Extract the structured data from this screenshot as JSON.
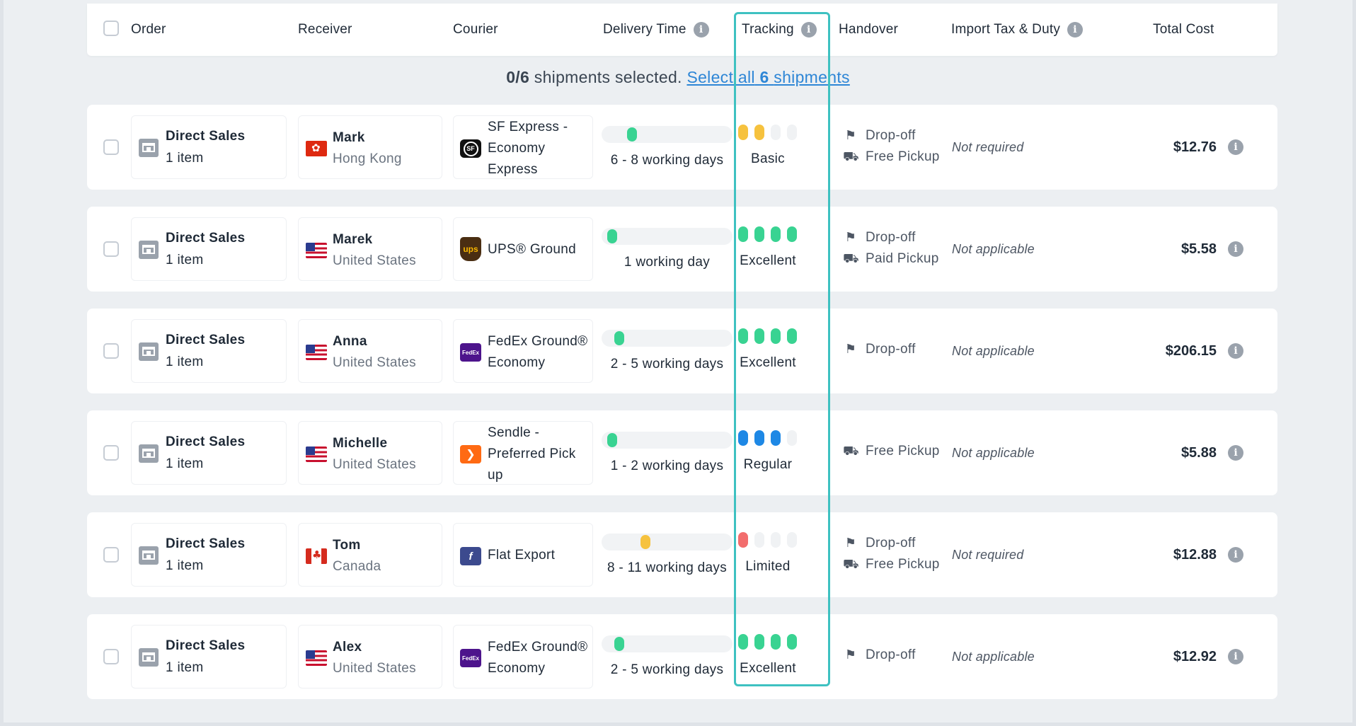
{
  "colors": {
    "green": "#39d392",
    "yellow": "#f6c23e",
    "blue": "#1e88e5",
    "red": "#f26d6d",
    "empty": "#f0f2f4",
    "highlight": "#3ec1c1",
    "link": "#2e86d6"
  },
  "header": {
    "order": "Order",
    "receiver": "Receiver",
    "courier": "Courier",
    "delivery_time": "Delivery Time",
    "tracking": "Tracking",
    "handover": "Handover",
    "import_tax": "Import Tax & Duty",
    "total_cost": "Total Cost"
  },
  "selection": {
    "count": "0/6",
    "text": "shipments selected.",
    "link_prefix": "Select all",
    "link_count": "6",
    "link_suffix": "shipments"
  },
  "rows": [
    {
      "order_title": "Direct Sales",
      "order_items": "1 item",
      "receiver_name": "Mark",
      "receiver_country": "Hong Kong",
      "flag": "hk-flag",
      "courier_lines": [
        "SF Express -",
        "Economy",
        "Express"
      ],
      "courier_logo": "sf-express-logo",
      "courier_logo_text": "SF",
      "delivery_text": "6 - 8 working days",
      "delivery_level": 0.2,
      "delivery_color": "green",
      "tracking_label": "Basic",
      "tracking_filled": 2,
      "tracking_color": "yellow",
      "handover": [
        "Drop-off",
        "Free Pickup"
      ],
      "tax": "Not required",
      "cost": "$12.76"
    },
    {
      "order_title": "Direct Sales",
      "order_items": "1 item",
      "receiver_name": "Marek",
      "receiver_country": "United States",
      "flag": "us-flag",
      "courier_lines": [
        "UPS® Ground"
      ],
      "courier_logo": "ups-logo",
      "courier_logo_text": "ups",
      "delivery_text": "1 working day",
      "delivery_level": 0.05,
      "delivery_color": "green",
      "tracking_label": "Excellent",
      "tracking_filled": 4,
      "tracking_color": "green",
      "handover": [
        "Drop-off",
        "Paid Pickup"
      ],
      "tax": "Not applicable",
      "cost": "$5.58"
    },
    {
      "order_title": "Direct Sales",
      "order_items": "1 item",
      "receiver_name": "Anna",
      "receiver_country": "United States",
      "flag": "us-flag",
      "courier_lines": [
        "FedEx Ground®",
        "Economy"
      ],
      "courier_logo": "fedex-logo",
      "courier_logo_text": "FedEx",
      "delivery_text": "2 - 5 working days",
      "delivery_level": 0.1,
      "delivery_color": "green",
      "tracking_label": "Excellent",
      "tracking_filled": 4,
      "tracking_color": "green",
      "handover": [
        "Drop-off"
      ],
      "tax": "Not applicable",
      "cost": "$206.15"
    },
    {
      "order_title": "Direct Sales",
      "order_items": "1 item",
      "receiver_name": "Michelle",
      "receiver_country": "United States",
      "flag": "us-flag",
      "courier_lines": [
        "Sendle -",
        "Preferred Pick",
        "up"
      ],
      "courier_logo": "sendle-logo",
      "courier_logo_text": "❯",
      "delivery_text": "1 - 2 working days",
      "delivery_level": 0.05,
      "delivery_color": "green",
      "tracking_label": "Regular",
      "tracking_filled": 3,
      "tracking_color": "blue",
      "handover": [
        "Free Pickup"
      ],
      "tax": "Not applicable",
      "cost": "$5.88"
    },
    {
      "order_title": "Direct Sales",
      "order_items": "1 item",
      "receiver_name": "Tom",
      "receiver_country": "Canada",
      "flag": "ca-flag",
      "courier_lines": [
        "Flat Export"
      ],
      "courier_logo": "flat-export-logo",
      "courier_logo_text": "f",
      "delivery_text": "8 - 11 working days",
      "delivery_level": 0.3,
      "delivery_color": "yellow",
      "tracking_label": "Limited",
      "tracking_filled": 1,
      "tracking_color": "red",
      "handover": [
        "Drop-off",
        "Free Pickup"
      ],
      "tax": "Not required",
      "cost": "$12.88"
    },
    {
      "order_title": "Direct Sales",
      "order_items": "1 item",
      "receiver_name": "Alex",
      "receiver_country": "United States",
      "flag": "us-flag",
      "courier_lines": [
        "FedEx Ground®",
        "Economy"
      ],
      "courier_logo": "fedex-logo",
      "courier_logo_text": "FedEx",
      "delivery_text": "2 - 5 working days",
      "delivery_level": 0.1,
      "delivery_color": "green",
      "tracking_label": "Excellent",
      "tracking_filled": 4,
      "tracking_color": "green",
      "handover": [
        "Drop-off"
      ],
      "tax": "Not applicable",
      "cost": "$12.92"
    }
  ]
}
